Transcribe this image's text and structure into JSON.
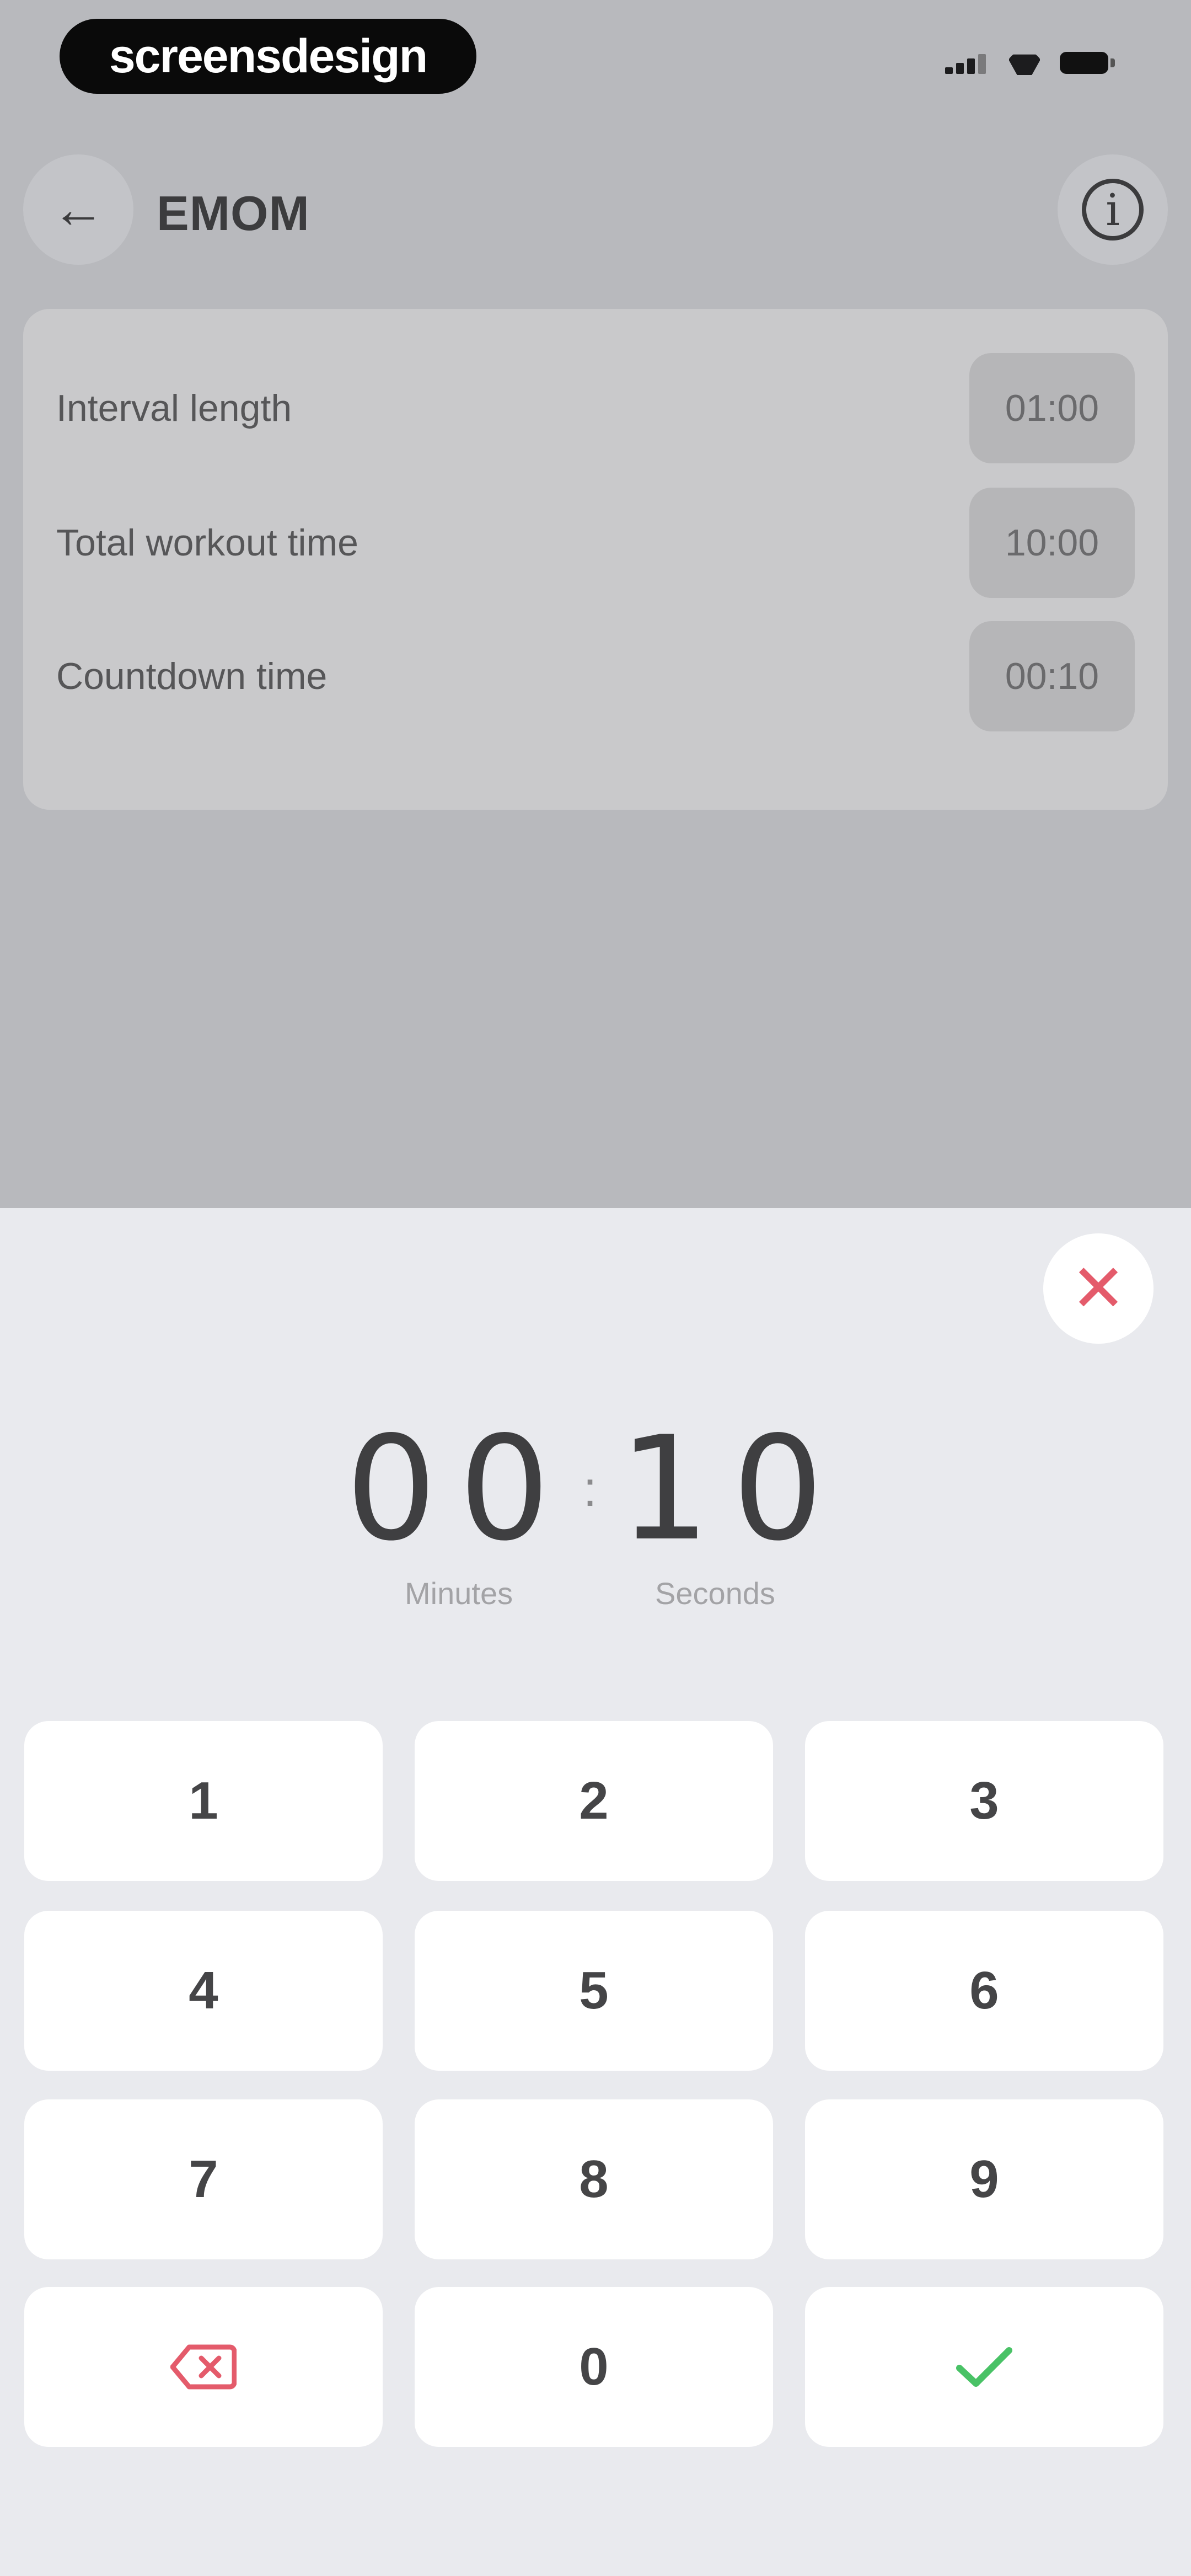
{
  "brand": {
    "text": "screensdesign"
  },
  "header": {
    "title": "EMOM"
  },
  "settings": [
    {
      "label": "Interval length",
      "value": "01:00"
    },
    {
      "label": "Total workout time",
      "value": "10:00"
    },
    {
      "label": "Countdown time",
      "value": "00:10"
    }
  ],
  "picker": {
    "minutes": "00",
    "seconds": "10",
    "minutes_label": "Minutes",
    "seconds_label": "Seconds"
  },
  "keypad": {
    "keys": [
      "1",
      "2",
      "3",
      "4",
      "5",
      "6",
      "7",
      "8",
      "9",
      "0"
    ]
  },
  "icons": {
    "back": "arrow-left-icon",
    "info": "info-icon",
    "close": "close-icon",
    "delete": "backspace-icon",
    "confirm": "check-icon"
  },
  "colors": {
    "accent_close": "#e45b6b",
    "accent_confirm": "#49c266"
  }
}
